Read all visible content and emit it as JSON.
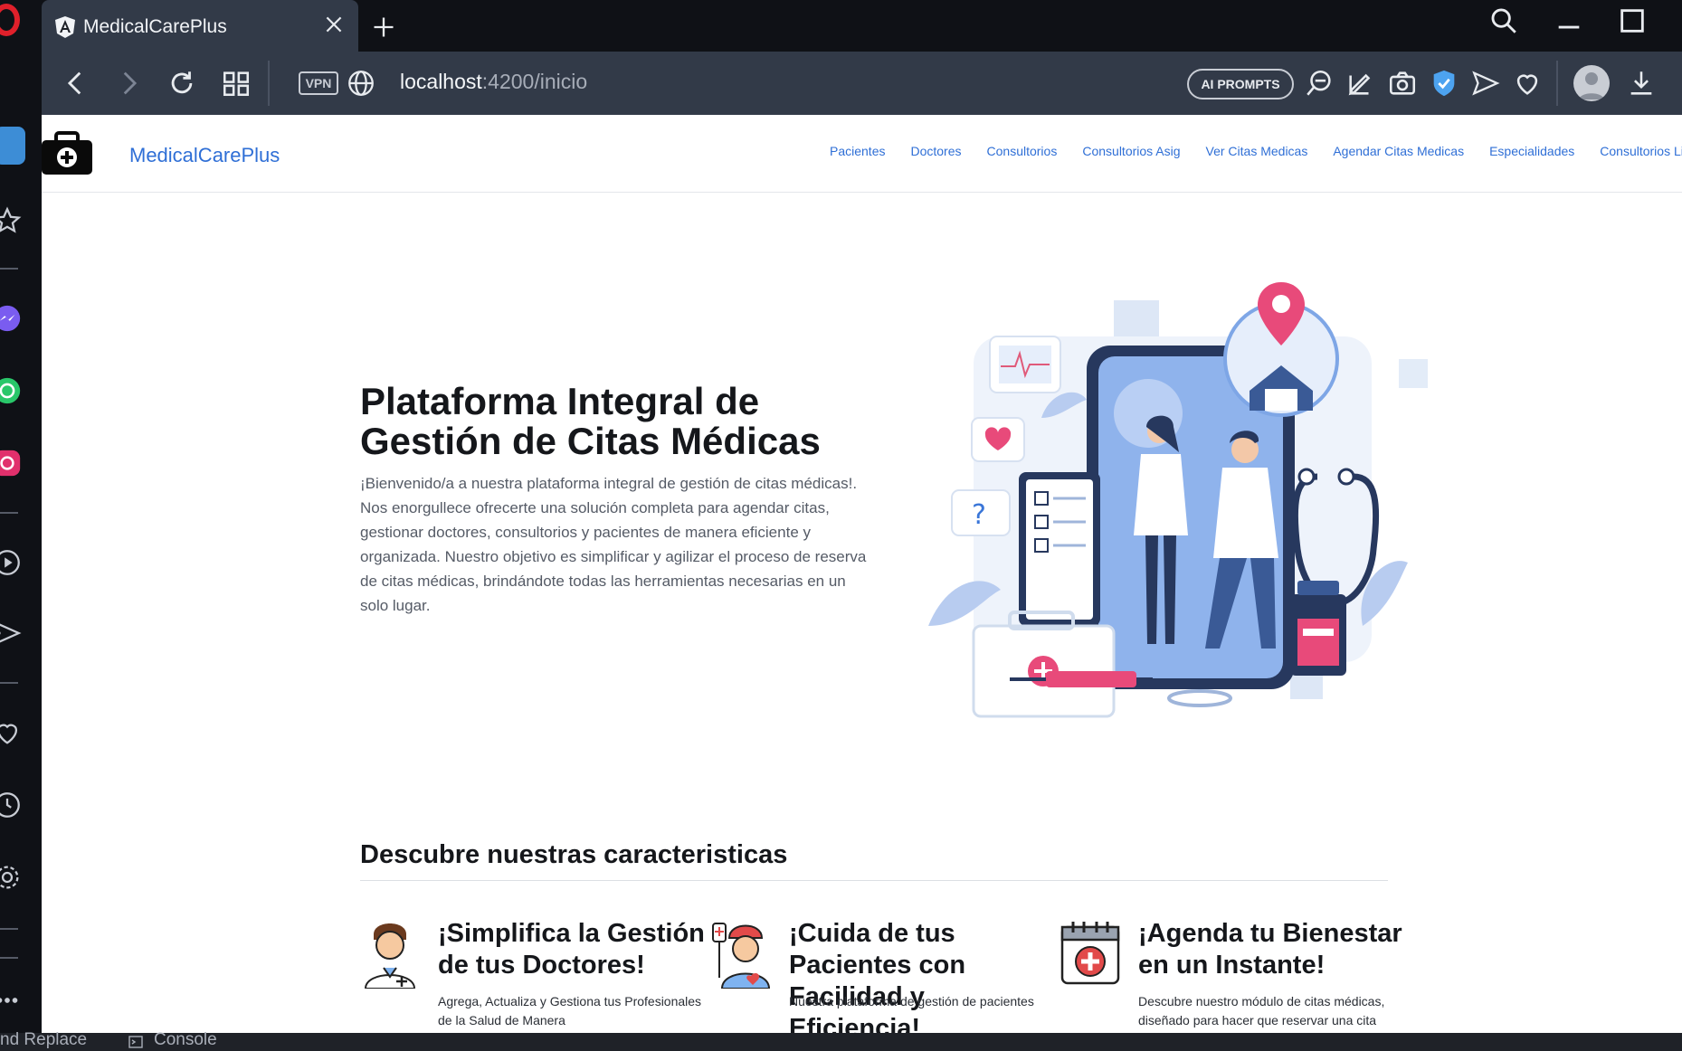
{
  "browser": {
    "tab_title": "MedicalCarePlus",
    "url_host": "localhost",
    "url_rest": ":4200/inicio",
    "vpn_label": "VPN",
    "ai_prompts_label": "AI PROMPTS"
  },
  "site": {
    "brand": "MedicalCarePlus",
    "nav": [
      "Pacientes",
      "Doctores",
      "Consultorios",
      "Consultorios Asig",
      "Ver Citas Medicas",
      "Agendar Citas Medicas",
      "Especialidades",
      "Consultorios Libr"
    ]
  },
  "hero": {
    "title": "Plataforma Integral de Gestión de Citas Médicas",
    "text": "¡Bienvenido/a a nuestra plataforma integral de gestión de citas médicas!. Nos enorgullece ofrecerte una solución completa para agendar citas, gestionar doctores, consultorios y pacientes de manera eficiente y organizada. Nuestro objetivo es simplificar y agilizar el proceso de reserva de citas médicas, brindándote todas las herramientas necesarias en un solo lugar."
  },
  "features": {
    "section_title": "Descubre nuestras caracteristicas",
    "items": [
      {
        "title": "¡Simplifica la Gestión de tus Doctores!",
        "text": "Agrega, Actualiza y Gestiona tus Profesionales de la Salud de Manera"
      },
      {
        "title": "¡Cuida de tus Pacientes con Facilidad y Eficiencia!",
        "text": "Nuestra plataforma de gestión de pacientes"
      },
      {
        "title": "¡Agenda tu Bienestar en un Instante!",
        "text": "Descubre nuestro módulo de citas médicas, diseñado para hacer que reservar una cita"
      }
    ]
  },
  "devtools": {
    "replace_label": "nd Replace",
    "console_label": "Console"
  },
  "colors": {
    "link": "#2f6fd6",
    "tab_bg": "#323a48",
    "sidebar_active": "#3d8dd6"
  }
}
